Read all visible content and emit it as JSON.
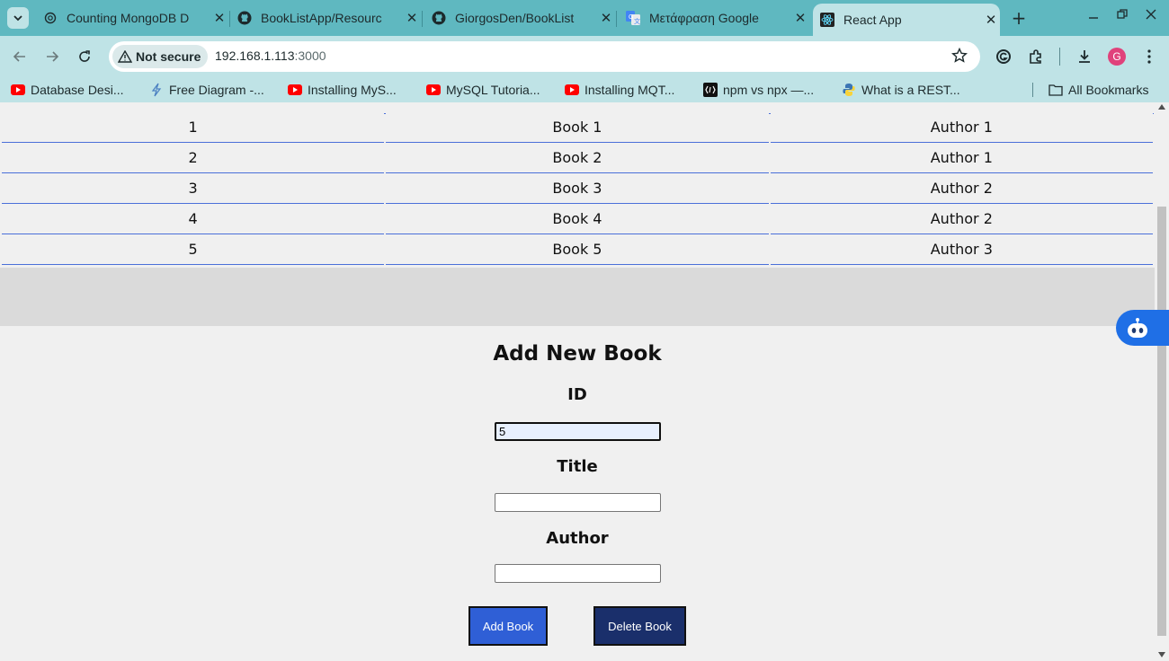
{
  "browser": {
    "tabs": [
      {
        "title": "Counting MongoDB D",
        "icon": "openai-icon",
        "active": false
      },
      {
        "title": "BookListApp/Resourc",
        "icon": "github-icon",
        "active": false
      },
      {
        "title": "GiorgosDen/BookList",
        "icon": "github-icon",
        "active": false
      },
      {
        "title": "Μετάφραση Google",
        "icon": "google-translate-icon",
        "active": false
      },
      {
        "title": "React App",
        "icon": "react-icon",
        "active": true
      }
    ],
    "omnibox": {
      "security_label": "Not secure",
      "host": "192.168.1.113",
      "port": ":3000"
    },
    "profile_initial": "G",
    "bookmarks": [
      {
        "label": "Database Desi...",
        "icon": "youtube-icon"
      },
      {
        "label": "Free Diagram -...",
        "icon": "diagram-icon"
      },
      {
        "label": "Installing MyS...",
        "icon": "youtube-icon"
      },
      {
        "label": "MySQL Tutoria...",
        "icon": "youtube-icon"
      },
      {
        "label": "Installing MQT...",
        "icon": "youtube-icon"
      },
      {
        "label": "npm vs npx —...",
        "icon": "dev-icon"
      },
      {
        "label": "What is a REST...",
        "icon": "python-icon"
      }
    ],
    "all_bookmarks_label": "All Bookmarks"
  },
  "books_table": {
    "rows": [
      {
        "id": "1",
        "title": "Book 1",
        "author": "Author 1"
      },
      {
        "id": "2",
        "title": "Book 2",
        "author": "Author 1"
      },
      {
        "id": "3",
        "title": "Book 3",
        "author": "Author 2"
      },
      {
        "id": "4",
        "title": "Book 4",
        "author": "Author 2"
      },
      {
        "id": "5",
        "title": "Book 5",
        "author": "Author 3"
      }
    ]
  },
  "form": {
    "heading": "Add New Book",
    "id_label": "ID",
    "id_value": "5",
    "title_label": "Title",
    "title_value": "",
    "author_label": "Author",
    "author_value": "",
    "add_button": "Add Book",
    "delete_button": "Delete Book"
  },
  "colors": {
    "tabstrip": "#5fb8c0",
    "toolbar": "#bfe3e6",
    "table_border": "#4a6fd9",
    "add_button": "#2f5fd6",
    "delete_button": "#1a2f6b"
  }
}
